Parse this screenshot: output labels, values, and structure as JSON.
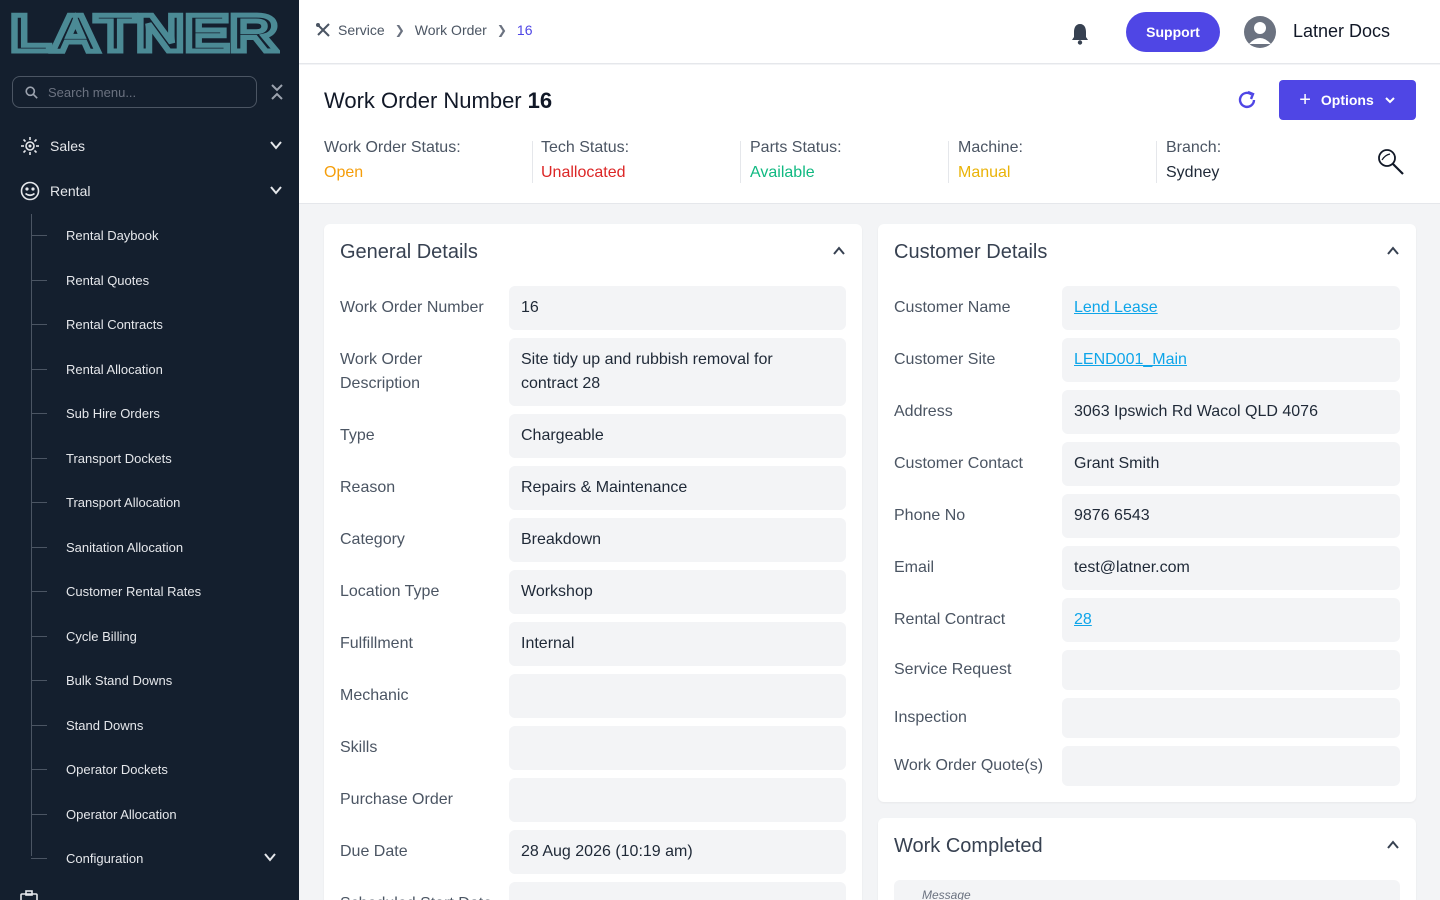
{
  "colors": {
    "sidebar_bg": "#141f2e",
    "accent": "#4f46e5",
    "status_open": "#f59e0b",
    "status_unallocated": "#dc2626",
    "status_available": "#10b981",
    "status_manual": "#eab308",
    "link": "#0ea5e9"
  },
  "sidebar": {
    "logo_text": "LATNER",
    "search_placeholder": "Search menu...",
    "sections": [
      {
        "label": "Sales",
        "icon": "sales-icon"
      },
      {
        "label": "Rental",
        "icon": "rental-icon"
      }
    ],
    "rental_items": [
      "Rental Daybook",
      "Rental Quotes",
      "Rental Contracts",
      "Rental Allocation",
      "Sub Hire Orders",
      "Transport Dockets",
      "Transport Allocation",
      "Sanitation Allocation",
      "Customer Rental Rates",
      "Cycle Billing",
      "Bulk Stand Downs",
      "Stand Downs",
      "Operator Dockets",
      "Operator Allocation",
      "Configuration"
    ]
  },
  "topbar": {
    "breadcrumb": [
      "Service",
      "Work Order",
      "16"
    ],
    "support_label": "Support",
    "user_name": "Latner Docs"
  },
  "header": {
    "title_label": "Work Order Number",
    "title_number": "16",
    "options_label": "Options",
    "statuses": [
      {
        "label": "Work Order Status:",
        "value": "Open",
        "color": "#f59e0b"
      },
      {
        "label": "Tech Status:",
        "value": "Unallocated",
        "color": "#dc2626"
      },
      {
        "label": "Parts Status:",
        "value": "Available",
        "color": "#10b981"
      },
      {
        "label": "Machine:",
        "value": "Manual",
        "color": "#eab308"
      },
      {
        "label": "Branch:",
        "value": "Sydney",
        "color": "#1f2937"
      }
    ]
  },
  "general_details": {
    "title": "General Details",
    "rows": [
      {
        "label": "Work Order Number",
        "value": "16"
      },
      {
        "label": "Work Order Description",
        "value": "Site tidy up and rubbish removal for contract 28"
      },
      {
        "label": "Type",
        "value": "Chargeable"
      },
      {
        "label": "Reason",
        "value": "Repairs & Maintenance"
      },
      {
        "label": "Category",
        "value": "Breakdown"
      },
      {
        "label": "Location Type",
        "value": "Workshop"
      },
      {
        "label": "Fulfillment",
        "value": "Internal"
      },
      {
        "label": "Mechanic",
        "value": ""
      },
      {
        "label": "Skills",
        "value": ""
      },
      {
        "label": "Purchase Order",
        "value": ""
      },
      {
        "label": "Due Date",
        "value": "28 Aug 2026 (10:19 am)"
      },
      {
        "label": "Scheduled Start Date",
        "value": ""
      }
    ]
  },
  "customer_details": {
    "title": "Customer Details",
    "rows": [
      {
        "label": "Customer Name",
        "value": "Lend Lease",
        "link": true
      },
      {
        "label": "Customer Site",
        "value": "LEND001_Main",
        "link": true
      },
      {
        "label": "Address",
        "value": "3063 Ipswich Rd Wacol QLD 4076",
        "link": false
      },
      {
        "label": "Customer Contact",
        "value": "Grant Smith",
        "link": false
      },
      {
        "label": "Phone No",
        "value": "9876 6543",
        "link": false
      },
      {
        "label": "Email",
        "value": "test@latner.com",
        "link": false
      },
      {
        "label": "Rental Contract",
        "value": "28",
        "link": true
      },
      {
        "label": "Service Request",
        "value": "",
        "link": false
      },
      {
        "label": "Inspection",
        "value": "",
        "link": false
      },
      {
        "label": "Work Order Quote(s)",
        "value": "",
        "link": false
      }
    ]
  },
  "work_completed": {
    "title": "Work Completed",
    "message_placeholder": "Message"
  }
}
